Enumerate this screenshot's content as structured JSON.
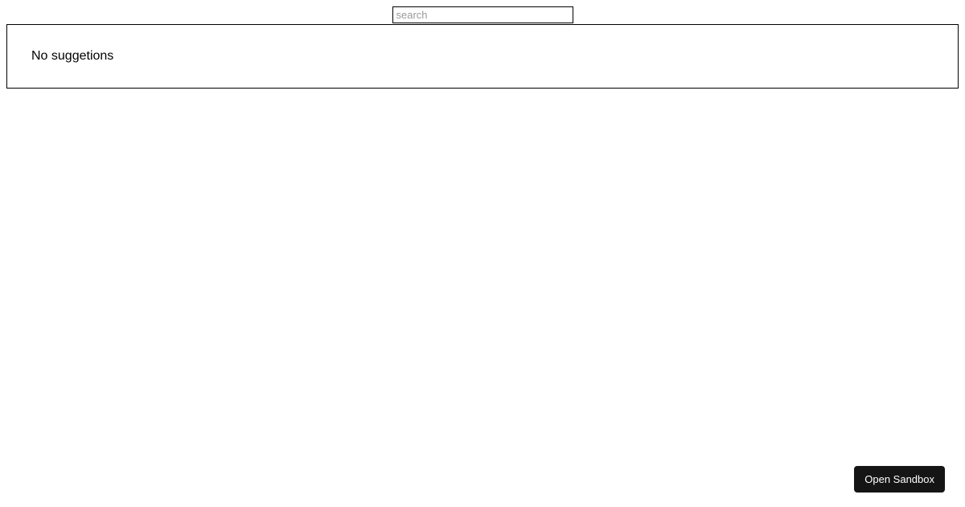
{
  "search": {
    "placeholder": "search",
    "value": ""
  },
  "suggestions": {
    "empty_message": "No suggetions"
  },
  "sandbox": {
    "button_label": "Open Sandbox"
  }
}
